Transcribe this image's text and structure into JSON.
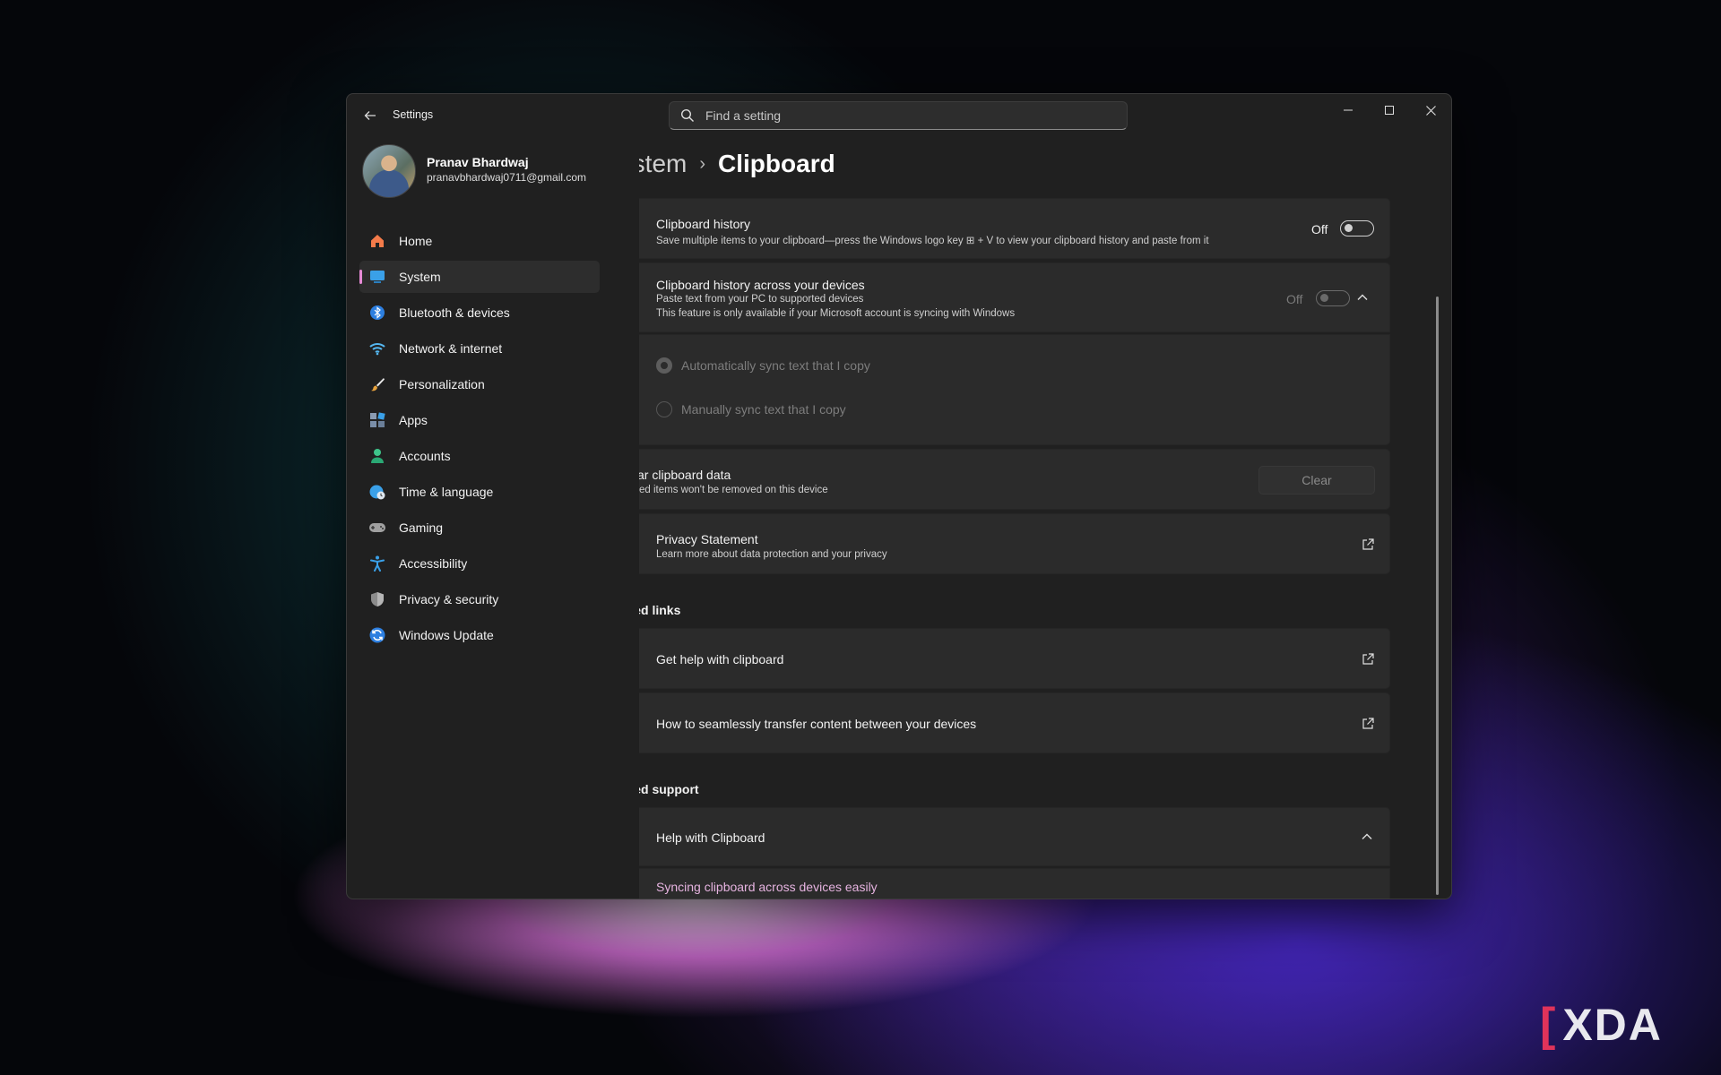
{
  "window": {
    "app_title": "Settings",
    "search_placeholder": "Find a setting"
  },
  "profile": {
    "name": "Pranav Bhardwaj",
    "email": "pranavbhardwaj0711@gmail.com"
  },
  "nav": [
    {
      "label": "Home",
      "icon": "home-icon",
      "color": "#f47b4a"
    },
    {
      "label": "System",
      "icon": "system-icon",
      "color": "#3aa0e8",
      "active": true
    },
    {
      "label": "Bluetooth & devices",
      "icon": "bluetooth-icon",
      "color": "#2d7fe0"
    },
    {
      "label": "Network & internet",
      "icon": "wifi-icon",
      "color": "#55b7f0"
    },
    {
      "label": "Personalization",
      "icon": "brush-icon",
      "color": "#e8a23c"
    },
    {
      "label": "Apps",
      "icon": "apps-icon",
      "color": "#7a8ea8"
    },
    {
      "label": "Accounts",
      "icon": "accounts-icon",
      "color": "#3ec48a"
    },
    {
      "label": "Time & language",
      "icon": "globe-clock-icon",
      "color": "#3aa0e8"
    },
    {
      "label": "Gaming",
      "icon": "gamepad-icon",
      "color": "#a0a0a0"
    },
    {
      "label": "Accessibility",
      "icon": "accessibility-icon",
      "color": "#3aa0e8"
    },
    {
      "label": "Privacy & security",
      "icon": "shield-icon",
      "color": "#8c8c8c"
    },
    {
      "label": "Windows Update",
      "icon": "update-icon",
      "color": "#2d7fe0"
    }
  ],
  "breadcrumb": {
    "parent": "System",
    "current": "Clipboard"
  },
  "clipboard_history": {
    "title": "Clipboard history",
    "subtitle": "Save multiple items to your clipboard—press the Windows logo key ⊞ + V to view your clipboard history and paste from it",
    "state": "Off"
  },
  "history_devices": {
    "title": "Clipboard history across your devices",
    "subtitle1": "Paste text from your PC to supported devices",
    "subtitle2": "This feature is only available if your Microsoft account is syncing with Windows",
    "state": "Off",
    "options": [
      {
        "label": "Automatically sync text that I copy",
        "checked": true
      },
      {
        "label": "Manually sync text that I copy",
        "checked": false
      }
    ]
  },
  "clear_data": {
    "title": "Clear clipboard data",
    "subtitle": "Pinned items won't be removed on this device",
    "button": "Clear"
  },
  "privacy": {
    "title": "Privacy Statement",
    "subtitle": "Learn more about data protection and your privacy"
  },
  "related_links": {
    "heading": "Related links",
    "items": [
      "Get help with clipboard",
      "How to seamlessly transfer content between your devices"
    ]
  },
  "related_support": {
    "heading": "Related support",
    "item": "Help with Clipboard",
    "link": "Syncing clipboard across devices easily"
  },
  "watermark": "XDA"
}
